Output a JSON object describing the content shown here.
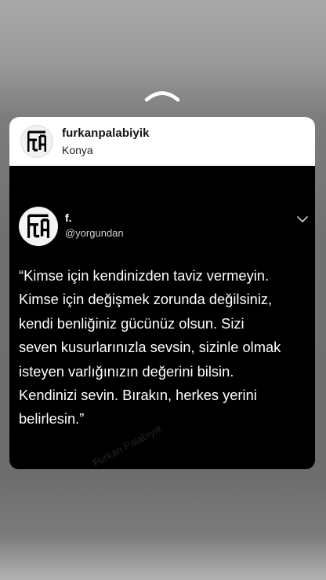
{
  "story": {
    "swipe_up_icon": "chevron-up-icon",
    "header": {
      "username": "furkanpalabiyik",
      "location": "Konya",
      "avatar_icon": "fp-monogram-logo"
    },
    "tweet": {
      "display_name": "f.",
      "handle": "@yorgundan",
      "avatar_icon": "fp-monogram-logo",
      "menu_icon": "chevron-down-icon",
      "text": "“Kimse için kendinizden taviz vermeyin.\nKimse için değişmek zorunda değilsiniz,\nkendi benliğiniz gücünüz olsun. Sizi\nseven kusurlarınızla sevsin, sizinle olmak\nisteyen varlığınızın değerini bilsin.\nKendinizi sevin. Bırakın, herkes yerini\nbelirlesin.”",
      "watermark": "Furkan Palabıyık"
    },
    "colors": {
      "card_header_bg": "#ffffff",
      "tweet_bg": "#000000",
      "tweet_text": "#ffffff",
      "backdrop": "#737373"
    }
  }
}
